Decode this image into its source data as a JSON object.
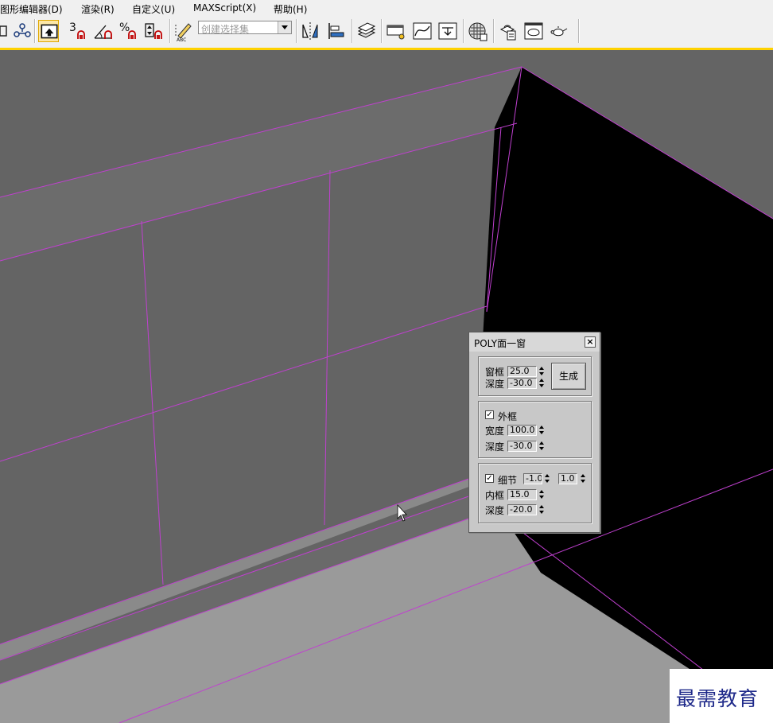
{
  "menu": {
    "items": [
      "图形编辑器(D)",
      "渲染(R)",
      "自定义(U)",
      "MAXScript(X)",
      "帮助(H)"
    ]
  },
  "toolbar": {
    "snap_label": "3",
    "percent_label": "%",
    "selection_set_placeholder": "创建选择集",
    "icons": [
      "select-link-icon",
      "unlink-icon",
      "select-object-icon",
      "snap-3d-icon",
      "angle-snap-icon",
      "percent-snap-icon",
      "spinner-snap-icon",
      "edit-named-selection-icon",
      "mirror-icon",
      "align-icon",
      "layer-manager-icon",
      "graphite-ribbon-icon",
      "curve-editor-icon",
      "schematic-view-icon",
      "material-editor-icon",
      "render-setup-icon",
      "rendered-frame-icon",
      "render-teapot-icon"
    ]
  },
  "dialog": {
    "title": "POLY面一窗",
    "close": "×",
    "group1": {
      "frame_label": "窗框",
      "frame_value": "25.0",
      "depth_label": "深度",
      "depth_value": "-30.0",
      "generate_label": "生成"
    },
    "group2": {
      "checkbox_label": "外框",
      "checked": true,
      "width_label": "宽度",
      "width_value": "100.0",
      "depth_label": "深度",
      "depth_value": "-30.0"
    },
    "group3": {
      "checkbox_label": "细节",
      "checked": true,
      "value_a": "-1.0",
      "value_b": "1.0",
      "inner_label": "内框",
      "inner_value": "15.0",
      "depth_label": "深度",
      "depth_value": "-20.0"
    }
  },
  "colors": {
    "accent": "#ffd200",
    "edge": "#c040d0",
    "wall": "#646464",
    "floor": "#999999",
    "void": "#000000"
  },
  "watermark": "最需教育"
}
